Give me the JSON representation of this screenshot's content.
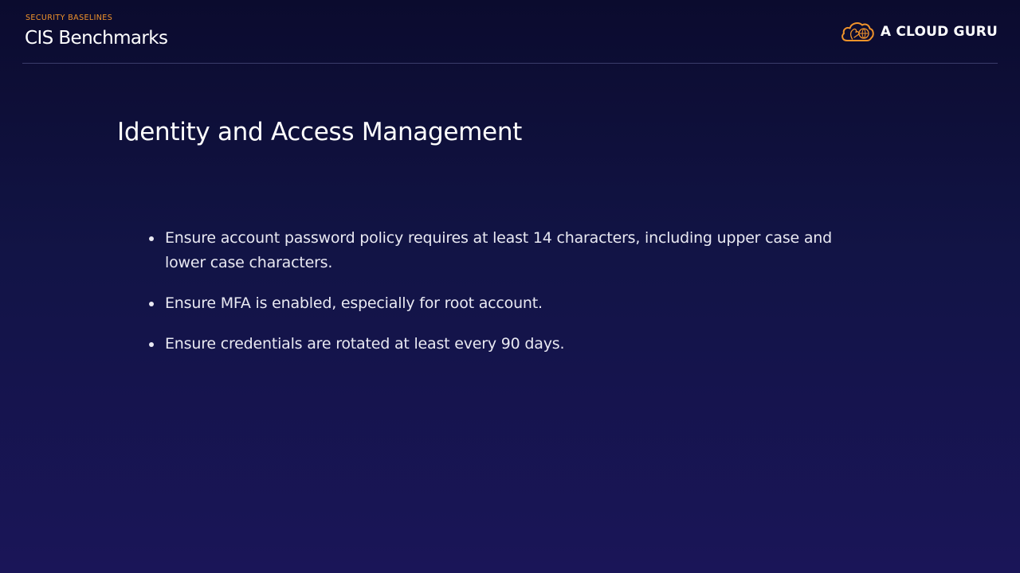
{
  "header": {
    "eyebrow": "SECURITY BASELINES",
    "title": "CIS Benchmarks",
    "logo": {
      "icon": "cloud-brain-icon",
      "text": "A CLOUD GURU",
      "accent_color": "#f0932b"
    }
  },
  "slide": {
    "heading": "Identity and Access Management",
    "bullets": [
      "Ensure account password policy requires at least 14 characters, including upper case and lower case characters.",
      "Ensure MFA is enabled, especially for root account.",
      "Ensure credentials are rotated at least every 90 days."
    ]
  },
  "colors": {
    "background_top": "#0b0b2e",
    "background_bottom": "#1a1558",
    "accent": "#f0932b",
    "text": "#ffffff"
  }
}
